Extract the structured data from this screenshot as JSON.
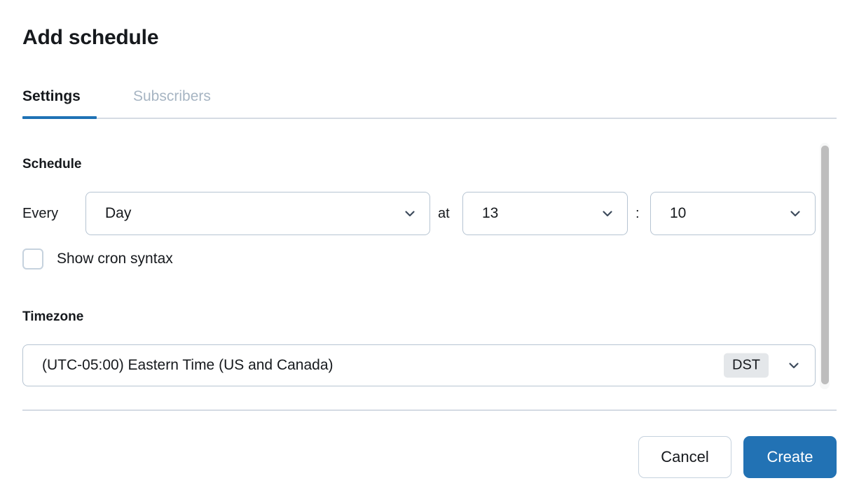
{
  "dialog": {
    "title": "Add schedule"
  },
  "tabs": [
    {
      "id": "settings",
      "label": "Settings",
      "active": true
    },
    {
      "id": "subscribers",
      "label": "Subscribers",
      "active": false
    }
  ],
  "schedule": {
    "heading": "Schedule",
    "every_label": "Every",
    "frequency_value": "Day",
    "at_label": "at",
    "hour_value": "13",
    "colon_label": ":",
    "minute_value": "10",
    "cron_checkbox_label": "Show cron syntax",
    "cron_checkbox_checked": false
  },
  "timezone": {
    "heading": "Timezone",
    "value": "(UTC-05:00) Eastern Time (US and Canada)",
    "dst_badge": "DST"
  },
  "footer": {
    "cancel_label": "Cancel",
    "create_label": "Create"
  },
  "icons": {
    "chevron_down": "chevron-down-icon"
  },
  "colors": {
    "accent_blue": "#2272b4",
    "tab_active_underline": "#1f72b5",
    "tab_inactive_text": "#a7b5c3",
    "border": "#b6c4d2",
    "divider": "#d5dbe3",
    "badge_bg": "#e4e7ea",
    "scrollbar_thumb": "#bdbdbd",
    "text": "#16191d"
  }
}
